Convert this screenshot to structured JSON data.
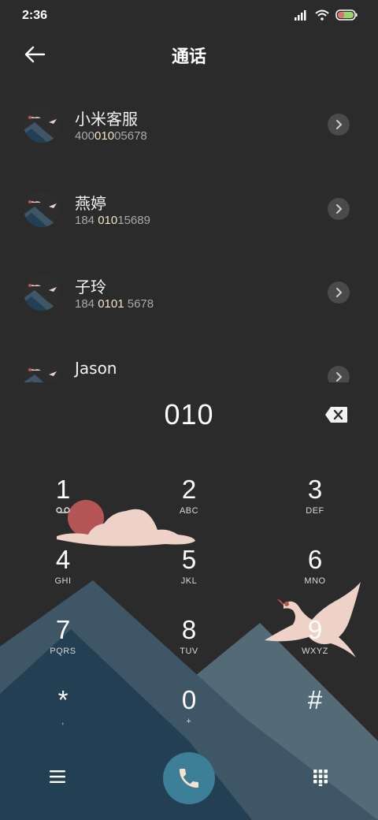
{
  "status_bar": {
    "time": "2:36"
  },
  "header": {
    "title": "通话"
  },
  "contacts": [
    {
      "name": "小米客服",
      "number_pre": "400",
      "number_hl": "010",
      "number_post": "05678"
    },
    {
      "name": "燕婷",
      "number_pre": "184 ",
      "number_hl": "010",
      "number_post": "15689"
    },
    {
      "name": "子玲",
      "number_pre": "184 ",
      "number_hl": "0101",
      "number_post": " 5678"
    },
    {
      "name": "Jason",
      "number_pre": "",
      "number_hl": "",
      "number_post": ""
    }
  ],
  "dialer": {
    "input": "010",
    "keys": [
      {
        "main": "1",
        "sub": ""
      },
      {
        "main": "2",
        "sub": "ABC"
      },
      {
        "main": "3",
        "sub": "DEF"
      },
      {
        "main": "4",
        "sub": "GHI"
      },
      {
        "main": "5",
        "sub": "JKL"
      },
      {
        "main": "6",
        "sub": "MNO"
      },
      {
        "main": "7",
        "sub": "PQRS"
      },
      {
        "main": "8",
        "sub": "TUV"
      },
      {
        "main": "9",
        "sub": "WXYZ"
      },
      {
        "main": "*",
        "sub": ","
      },
      {
        "main": "0",
        "sub": "+"
      },
      {
        "main": "#",
        "sub": ""
      }
    ]
  },
  "icons": {
    "back": "back-arrow-icon",
    "delete": "backspace-icon",
    "menu": "menu-icon",
    "call": "phone-icon",
    "keypad": "keypad-icon",
    "voicemail": "voicemail-icon"
  }
}
